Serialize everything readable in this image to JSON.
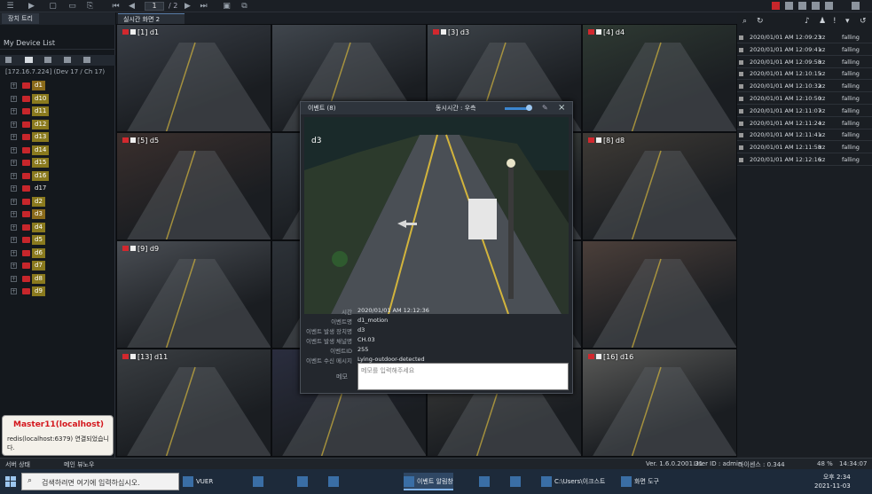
{
  "toolbar": {
    "page_current": "1",
    "page_total": "/ 2"
  },
  "sidebar": {
    "tab_label": "장치 트리",
    "title": "My Device List",
    "root": "[172.16.7.224] (Dev 17 / Ch 17)",
    "items": [
      {
        "label": "d1",
        "style": "sel"
      },
      {
        "label": "d10",
        "style": "hi"
      },
      {
        "label": "d11",
        "style": "hi"
      },
      {
        "label": "d12",
        "style": "hi"
      },
      {
        "label": "d13",
        "style": "hi"
      },
      {
        "label": "d14",
        "style": "hi"
      },
      {
        "label": "d15",
        "style": "hi"
      },
      {
        "label": "d16",
        "style": "hi"
      },
      {
        "label": "d17",
        "style": ""
      },
      {
        "label": "d2",
        "style": "hi"
      },
      {
        "label": "d3",
        "style": "sel"
      },
      {
        "label": "d4",
        "style": "hi"
      },
      {
        "label": "d5",
        "style": "hi"
      },
      {
        "label": "d6",
        "style": "hi"
      },
      {
        "label": "d7",
        "style": "hi"
      },
      {
        "label": "d8",
        "style": "hi"
      },
      {
        "label": "d9",
        "style": "hi"
      }
    ]
  },
  "server_popup": {
    "title": "Master11(localhost)",
    "message": "redis(localhost:6379) 연결되었습니다."
  },
  "tabs": {
    "live_tab": "실시간 화면 2"
  },
  "tiles": [
    {
      "label": "[1] d1",
      "color": "#3a3f47"
    },
    {
      "label": "",
      "color": "#40464d"
    },
    {
      "label": "[3] d3",
      "color": "#3d4349"
    },
    {
      "label": "[4] d4",
      "color": "#2f3a33"
    },
    {
      "label": "[5] d5",
      "color": "#3a2f2d"
    },
    {
      "label": "",
      "color": "#30363c"
    },
    {
      "label": "",
      "color": "#4a5049"
    },
    {
      "label": "[8] d8",
      "color": "#3f3b36"
    },
    {
      "label": "[9] d9",
      "color": "#4a4e54"
    },
    {
      "label": "",
      "color": "#2d3238"
    },
    {
      "label": "",
      "color": "#3b3f44"
    },
    {
      "label": "",
      "color": "#4b3f3a"
    },
    {
      "label": "[13] d11",
      "color": "#3a3e42"
    },
    {
      "label": "",
      "color": "#2a2d3e"
    },
    {
      "label": "",
      "color": "#3d3d3b"
    },
    {
      "label": "[16] d16",
      "color": "#5a5a58"
    }
  ],
  "events": [
    {
      "time": "2020/01/01 AM 12:09:23",
      "dev": "xz",
      "type": "falling"
    },
    {
      "time": "2020/01/01 AM 12:09:41",
      "dev": "xz",
      "type": "falling"
    },
    {
      "time": "2020/01/01 AM 12:09:58",
      "dev": "xz",
      "type": "falling"
    },
    {
      "time": "2020/01/01 AM 12:10:15",
      "dev": "xz",
      "type": "falling"
    },
    {
      "time": "2020/01/01 AM 12:10:32",
      "dev": "xz",
      "type": "falling"
    },
    {
      "time": "2020/01/01 AM 12:10:50",
      "dev": "xz",
      "type": "falling"
    },
    {
      "time": "2020/01/01 AM 12:11:07",
      "dev": "xz",
      "type": "falling"
    },
    {
      "time": "2020/01/01 AM 12:11:24",
      "dev": "xz",
      "type": "falling"
    },
    {
      "time": "2020/01/01 AM 12:11:41",
      "dev": "xz",
      "type": "falling"
    },
    {
      "time": "2020/01/01 AM 12:11:58",
      "dev": "xz",
      "type": "falling"
    },
    {
      "time": "2020/01/01 AM 12:12:16",
      "dev": "xz",
      "type": "falling"
    }
  ],
  "dialog": {
    "title": "이벤트 (8)",
    "option": "동시시간 : 우측",
    "image_label": "d3",
    "fields": [
      {
        "k": "시간",
        "v": "2020/01/01 AM 12:12:36"
      },
      {
        "k": "이벤트명",
        "v": "d1_motion"
      },
      {
        "k": "이벤트 발생 장치명",
        "v": "d3"
      },
      {
        "k": "이벤트 발생 채널명",
        "v": "CH.03"
      },
      {
        "k": "이벤트ID",
        "v": "255"
      },
      {
        "k": "이벤트 수신 메시지",
        "v": "Lying-outdoor-detected"
      }
    ],
    "memo_label": "메모",
    "memo_placeholder": "메모를 입력해주세요"
  },
  "statusbar": {
    "left": "서버 상태",
    "mid": "메인 뷰노우",
    "version": "Ver. 1.6.0.2001.31",
    "user": "User ID : admin",
    "stat1": "라이센스 : 0.344",
    "stat2": "48 %",
    "time": "14:34:07"
  },
  "taskbar": {
    "search_placeholder": "검색하려면 여기에 입력하십시오.",
    "apps": [
      "VUER",
      "",
      "",
      "",
      "이벤트 알림창",
      "",
      "",
      "C:\\Users\\이크스트",
      "화면 도구"
    ],
    "clock_time": "오후 2:34",
    "clock_date": "2021-11-03"
  }
}
